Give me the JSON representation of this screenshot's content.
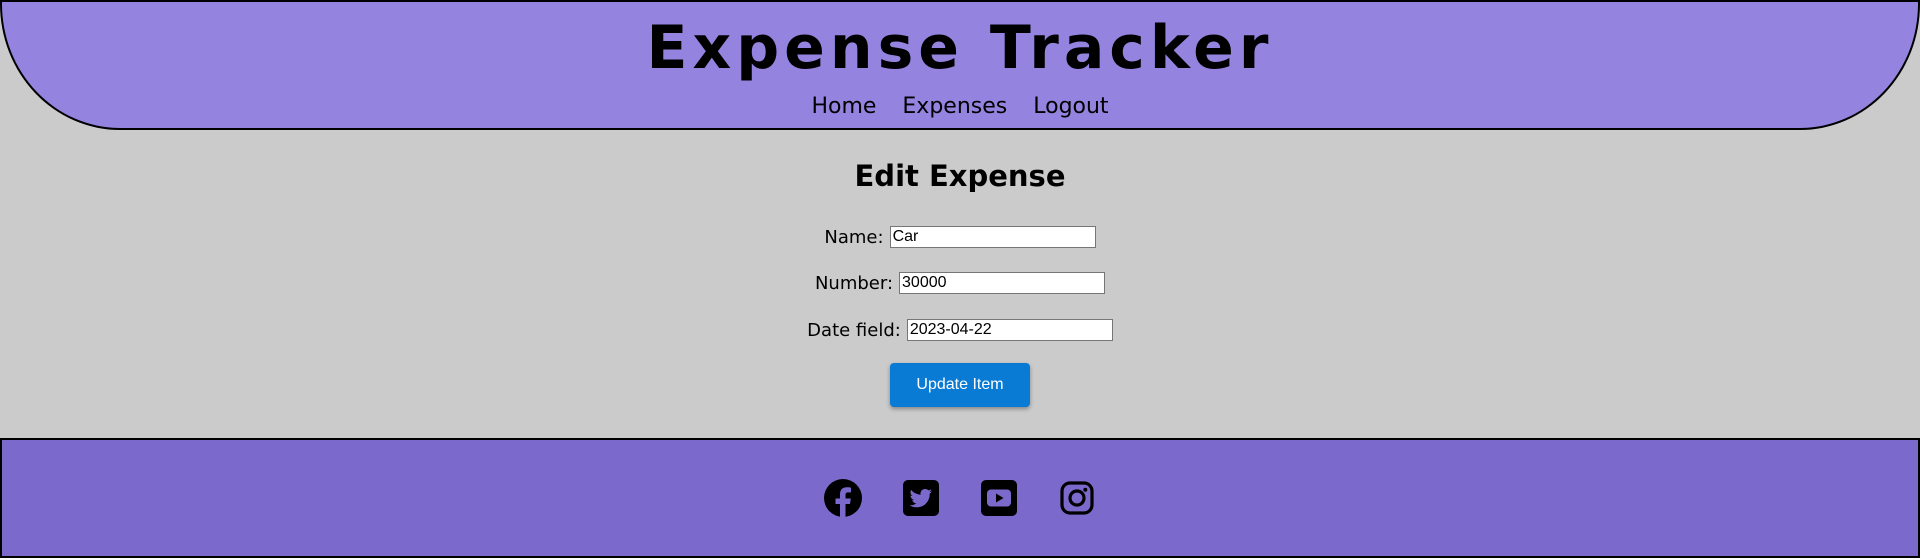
{
  "header": {
    "title": "Expense Tracker",
    "nav": [
      {
        "label": "Home"
      },
      {
        "label": "Expenses"
      },
      {
        "label": "Logout"
      }
    ]
  },
  "form": {
    "heading": "Edit Expense",
    "name_label": "Name:",
    "name_value": "Car",
    "number_label": "Number:",
    "number_value": "30000",
    "date_label": "Date field:",
    "date_value": "2023-04-22",
    "submit_label": "Update Item"
  },
  "footer": {
    "social": [
      {
        "icon": "facebook-icon"
      },
      {
        "icon": "twitter-icon"
      },
      {
        "icon": "youtube-icon"
      },
      {
        "icon": "instagram-icon"
      }
    ]
  },
  "colors": {
    "background": "#cbcbcb",
    "header": "#9484e0",
    "footer": "#7b6acb",
    "button": "#0a7bd4"
  }
}
